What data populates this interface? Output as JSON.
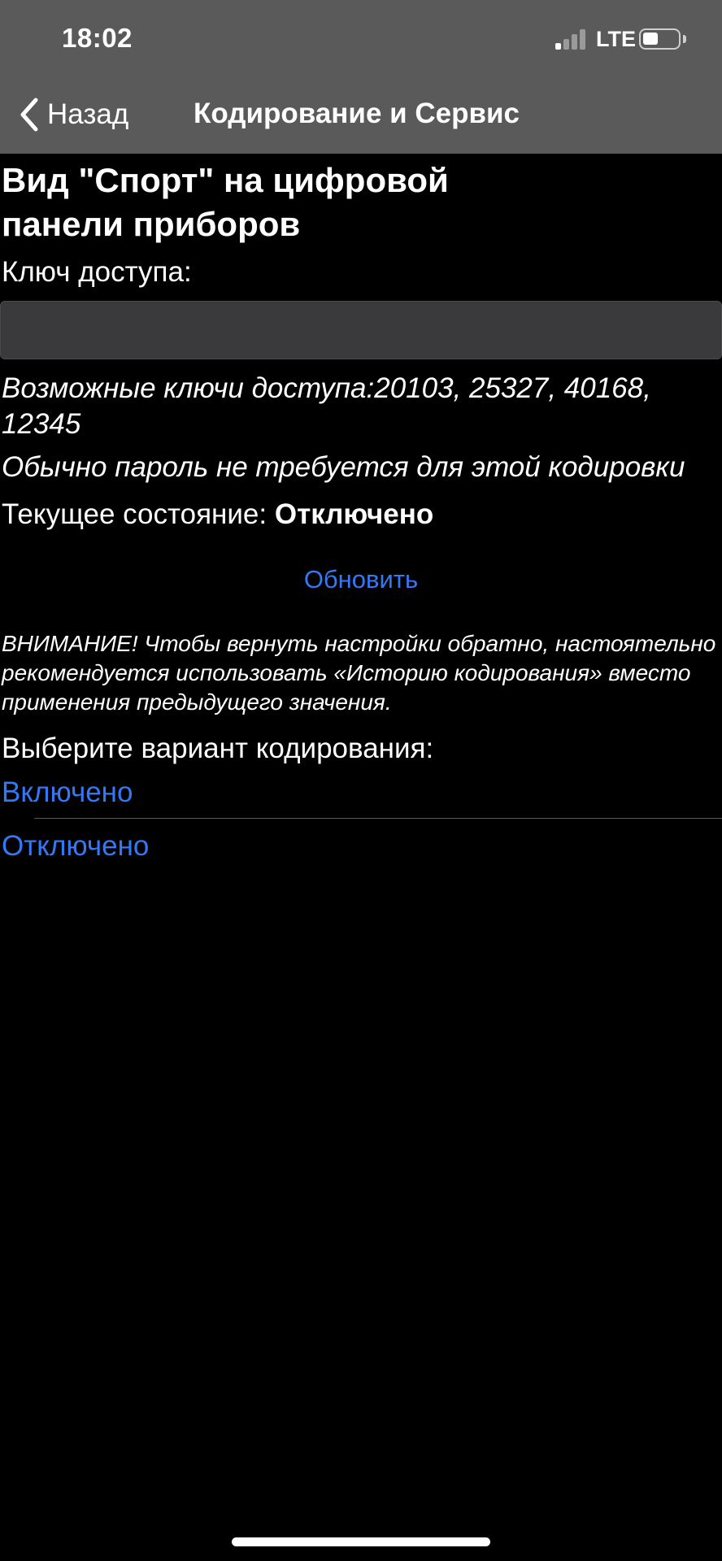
{
  "status_bar": {
    "time": "18:02",
    "network": "LTE",
    "signal_bars_active": 1,
    "signal_bars_total": 4,
    "battery_level": 0.45,
    "icons": [
      "signal-icon",
      "battery-icon"
    ]
  },
  "nav": {
    "back_label": "Назад",
    "title": "Кодирование и Сервис",
    "back_icon": "chevron-left-icon"
  },
  "main": {
    "title": "Вид \"Спорт\" на цифровой панели приборов",
    "key_label": "Ключ доступа:",
    "key_value": "",
    "possible_keys": "Возможные ключи доступа:20103, 25327, 40168, 12345",
    "password_note": "Обычно пароль не требуется для этой кодировки",
    "current_state_label": "Текущее состояние:",
    "current_state_value": "Отключено",
    "refresh_label": "Обновить",
    "warning": "ВНИМАНИЕ! Чтобы вернуть настройки обратно, настоятельно рекомендуется использовать «Историю кодирования» вместо применения предыдущего значения.",
    "choose_label": "Выберите вариант кодирования:",
    "options": [
      {
        "label": "Включено"
      },
      {
        "label": "Отключено"
      }
    ]
  },
  "colors": {
    "background": "#000000",
    "header": "#5a5a5a",
    "accent": "#3478f6",
    "input_bg": "#3a3a3c",
    "text": "#ffffff"
  }
}
